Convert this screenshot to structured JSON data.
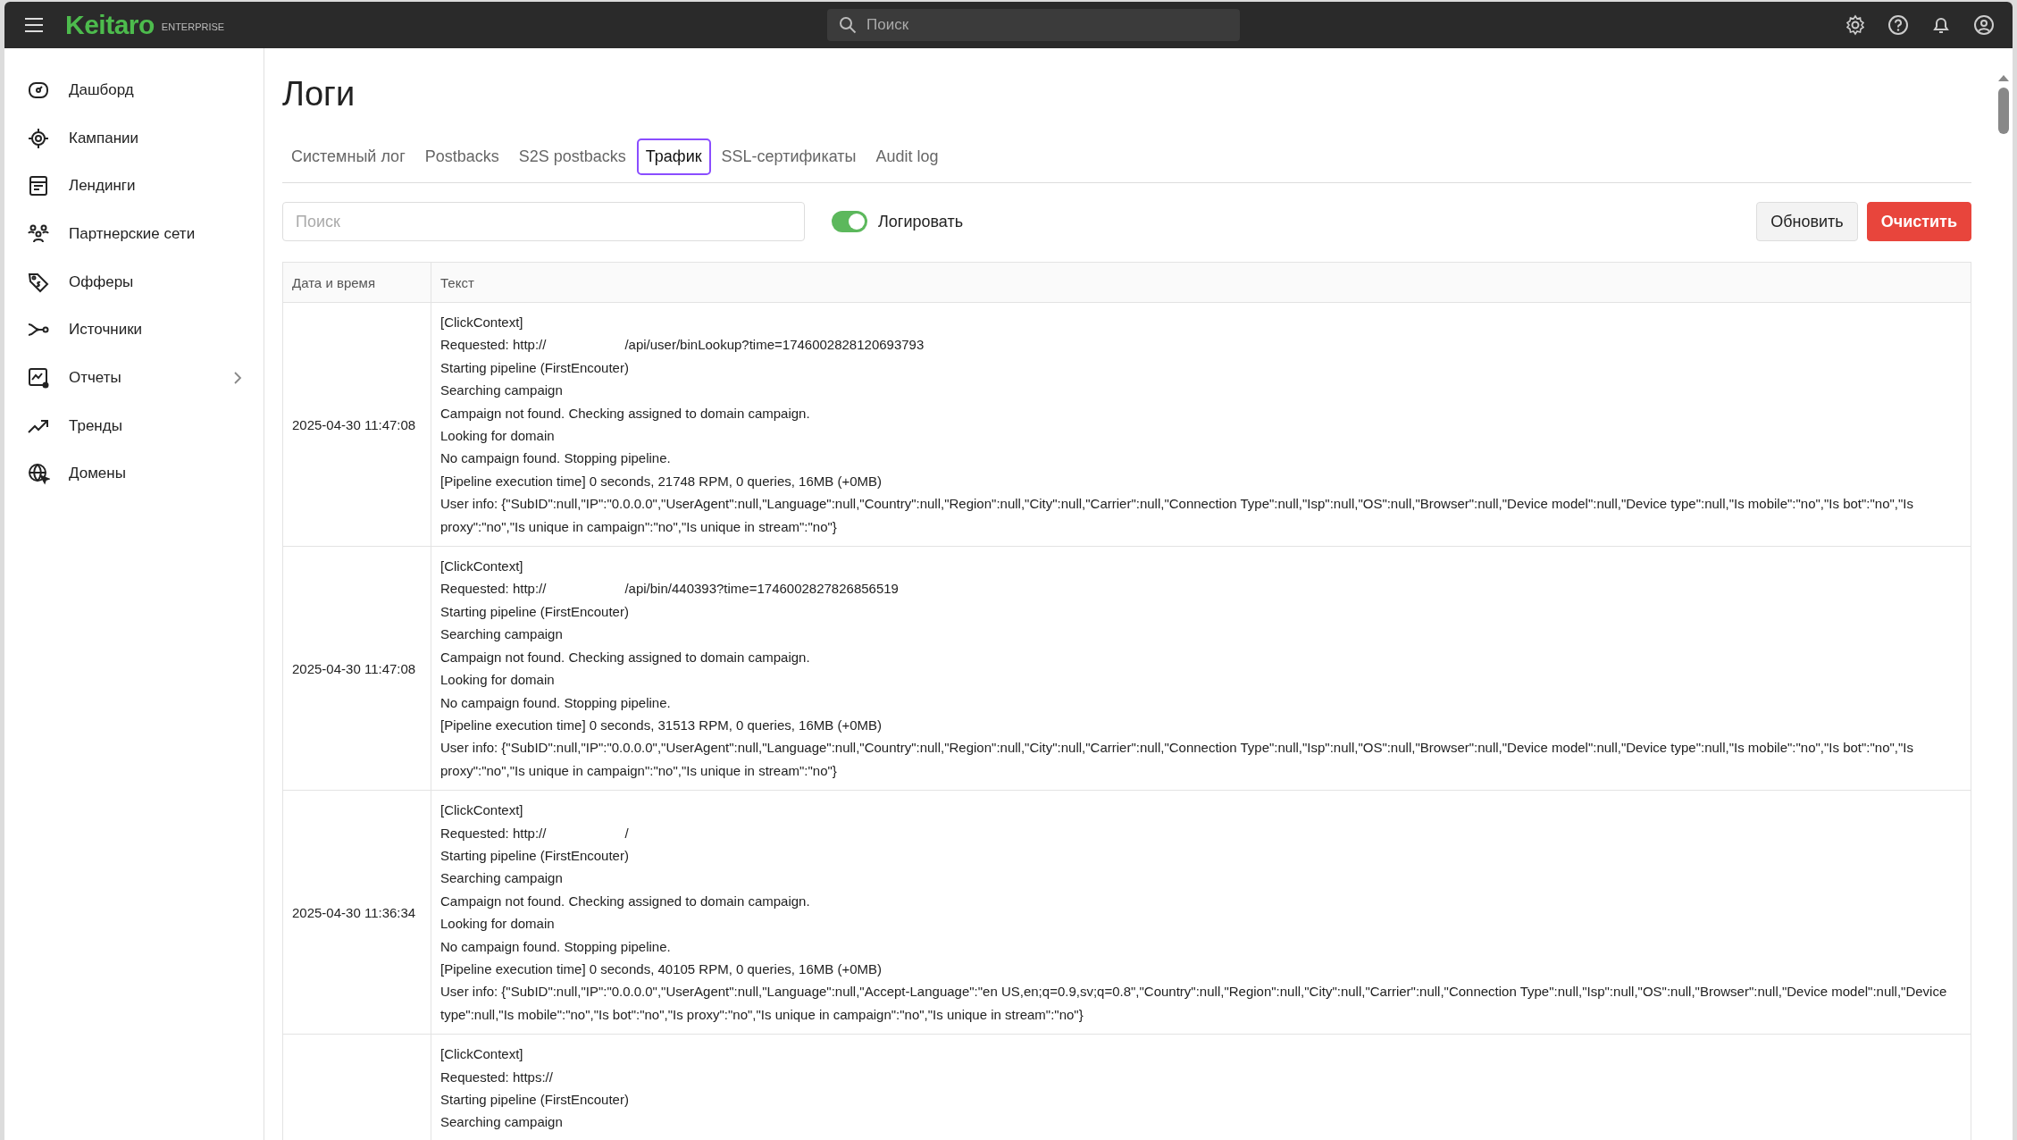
{
  "topbar": {
    "logo": "Keitaro",
    "edition": "ENTERPRISE",
    "search": {
      "placeholder": "Поиск"
    }
  },
  "sidebar": {
    "items": [
      {
        "label": "Дашборд",
        "expandable": false
      },
      {
        "label": "Кампании",
        "expandable": false
      },
      {
        "label": "Лендинги",
        "expandable": false
      },
      {
        "label": "Партнерские сети",
        "expandable": false
      },
      {
        "label": "Офферы",
        "expandable": false
      },
      {
        "label": "Источники",
        "expandable": false
      },
      {
        "label": "Отчеты",
        "expandable": true
      },
      {
        "label": "Тренды",
        "expandable": false
      },
      {
        "label": "Домены",
        "expandable": false
      }
    ]
  },
  "page": {
    "title": "Логи"
  },
  "tabs": [
    {
      "label": "Системный лог",
      "selected": false
    },
    {
      "label": "Postbacks",
      "selected": false
    },
    {
      "label": "S2S postbacks",
      "selected": false
    },
    {
      "label": "Трафик",
      "selected": true
    },
    {
      "label": "SSL-сертификаты",
      "selected": false
    },
    {
      "label": "Audit log",
      "selected": false
    }
  ],
  "toolbar": {
    "search": {
      "placeholder": "Поиск"
    },
    "log_toggle": {
      "label": "Логировать",
      "on": true
    },
    "buttons": [
      {
        "label": "Обновить",
        "kind": "default"
      },
      {
        "label": "Очистить",
        "kind": "danger"
      }
    ]
  },
  "table": {
    "columns": [
      "Дата и время",
      "Текст"
    ],
    "rows": [
      {
        "date": "2025-04-30 11:47:08",
        "lines": [
          {
            "kind": "text",
            "text": "[ClickContext]"
          },
          {
            "kind": "request",
            "scheme": "Requested: http://",
            "path": "/api/user/binLookup?time=1746002828120693793"
          },
          {
            "kind": "text",
            "text": "Starting pipeline (FirstEncouter)"
          },
          {
            "kind": "text",
            "text": "Searching campaign"
          },
          {
            "kind": "text",
            "text": "Campaign not found. Checking assigned to domain campaign."
          },
          {
            "kind": "text",
            "text": "Looking for domain"
          },
          {
            "kind": "text",
            "text": "No campaign found. Stopping pipeline."
          },
          {
            "kind": "text",
            "text": "[Pipeline execution time] 0 seconds, 21748 RPM, 0 queries, 16MB (+0MB)"
          },
          {
            "kind": "text",
            "text": "User info: {\"SubID\":null,\"IP\":\"0.0.0.0\",\"UserAgent\":null,\"Language\":null,\"Country\":null,\"Region\":null,\"City\":null,\"Carrier\":null,\"Connection Type\":null,\"Isp\":null,\"OS\":null,\"Browser\":null,\"Device model\":null,\"Device type\":null,\"Is mobile\":\"no\",\"Is bot\":\"no\",\"Is proxy\":\"no\",\"Is unique in campaign\":\"no\",\"Is unique in stream\":\"no\"}"
          }
        ]
      },
      {
        "date": "2025-04-30 11:47:08",
        "lines": [
          {
            "kind": "text",
            "text": "[ClickContext]"
          },
          {
            "kind": "request",
            "scheme": "Requested: http://",
            "path": "/api/bin/440393?time=1746002827826856519"
          },
          {
            "kind": "text",
            "text": "Starting pipeline (FirstEncouter)"
          },
          {
            "kind": "text",
            "text": "Searching campaign"
          },
          {
            "kind": "text",
            "text": "Campaign not found. Checking assigned to domain campaign."
          },
          {
            "kind": "text",
            "text": "Looking for domain"
          },
          {
            "kind": "text",
            "text": "No campaign found. Stopping pipeline."
          },
          {
            "kind": "text",
            "text": "[Pipeline execution time] 0 seconds, 31513 RPM, 0 queries, 16MB (+0MB)"
          },
          {
            "kind": "text",
            "text": "User info: {\"SubID\":null,\"IP\":\"0.0.0.0\",\"UserAgent\":null,\"Language\":null,\"Country\":null,\"Region\":null,\"City\":null,\"Carrier\":null,\"Connection Type\":null,\"Isp\":null,\"OS\":null,\"Browser\":null,\"Device model\":null,\"Device type\":null,\"Is mobile\":\"no\",\"Is bot\":\"no\",\"Is proxy\":\"no\",\"Is unique in campaign\":\"no\",\"Is unique in stream\":\"no\"}"
          }
        ]
      },
      {
        "date": "2025-04-30 11:36:34",
        "lines": [
          {
            "kind": "text",
            "text": "[ClickContext]"
          },
          {
            "kind": "request",
            "scheme": "Requested: http://",
            "path": "/"
          },
          {
            "kind": "text",
            "text": "Starting pipeline (FirstEncouter)"
          },
          {
            "kind": "text",
            "text": "Searching campaign"
          },
          {
            "kind": "text",
            "text": "Campaign not found. Checking assigned to domain campaign."
          },
          {
            "kind": "text",
            "text": "Looking for domain"
          },
          {
            "kind": "text",
            "text": "No campaign found. Stopping pipeline."
          },
          {
            "kind": "text",
            "text": "[Pipeline execution time] 0 seconds, 40105 RPM, 0 queries, 16MB (+0MB)"
          },
          {
            "kind": "text",
            "text": "User info: {\"SubID\":null,\"IP\":\"0.0.0.0\",\"UserAgent\":null,\"Language\":null,\"Accept-Language\":\"en US,en;q=0.9,sv;q=0.8\",\"Country\":null,\"Region\":null,\"City\":null,\"Carrier\":null,\"Connection Type\":null,\"Isp\":null,\"OS\":null,\"Browser\":null,\"Device model\":null,\"Device type\":null,\"Is mobile\":\"no\",\"Is bot\":\"no\",\"Is proxy\":\"no\",\"Is unique in campaign\":\"no\",\"Is unique in stream\":\"no\"}"
          }
        ]
      },
      {
        "lines": [
          {
            "kind": "text",
            "text": "[ClickContext]"
          },
          {
            "kind": "request",
            "scheme": "Requested: https://"
          },
          {
            "kind": "text",
            "text": "Starting pipeline (FirstEncouter)"
          },
          {
            "kind": "text",
            "text": "Searching campaign"
          }
        ]
      }
    ]
  }
}
